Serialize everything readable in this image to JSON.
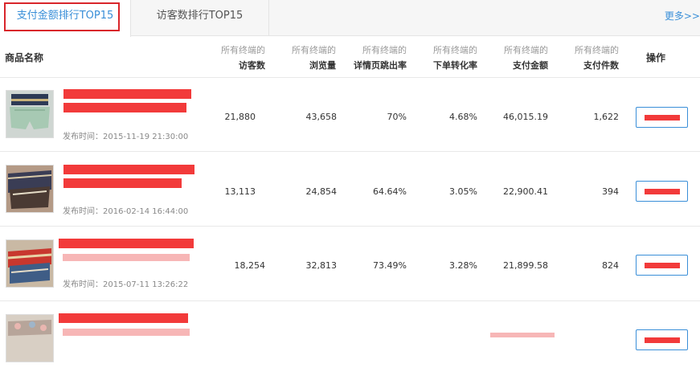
{
  "tabs": [
    {
      "label": "支付金额排行TOP15",
      "active": true
    },
    {
      "label": "访客数排行TOP15",
      "active": false
    }
  ],
  "more_label": "更多>>",
  "columns": {
    "product": "商品名称",
    "metric_prefix": "所有终端的",
    "visitors": "访客数",
    "views": "浏览量",
    "bounce": "详情页跳出率",
    "conversion": "下单转化率",
    "amount": "支付金额",
    "pieces": "支付件数",
    "action": "操作"
  },
  "rows": [
    {
      "published": "发布时间：2015-11-19 21:30:00",
      "visitors": "21,880",
      "views": "43,658",
      "bounce": "70%",
      "conversion": "4.68%",
      "amount": "46,015.19",
      "pieces": "1,622"
    },
    {
      "published": "发布时间：2016-02-14 16:44:00",
      "visitors": "13,113",
      "views": "24,854",
      "bounce": "64.64%",
      "conversion": "3.05%",
      "amount": "22,900.41",
      "pieces": "394"
    },
    {
      "published": "发布时间：2015-07-11 13:26:22",
      "visitors": "18,254",
      "views": "32,813",
      "bounce": "73.49%",
      "conversion": "3.28%",
      "amount": "21,899.58",
      "pieces": "824"
    }
  ],
  "colors": {
    "accent": "#3a8fd8",
    "highlight_border": "#d9262b",
    "redaction": "#f23a3a"
  }
}
